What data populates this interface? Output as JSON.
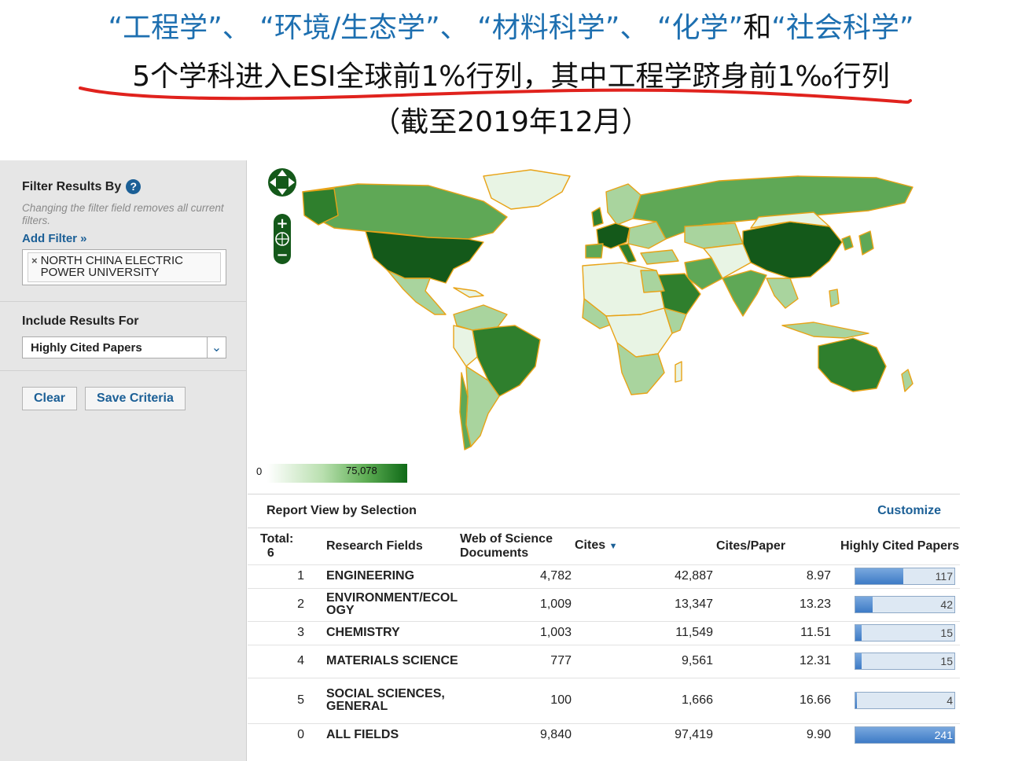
{
  "slide": {
    "line1_parts": [
      "“工程学”",
      "、",
      "“环境/生态学”",
      "、",
      "“材料科学”",
      "、",
      "“化学”"
    ],
    "line1_and": "和",
    "line1_last": "“社会科学”",
    "line2": "5个学科进入ESI全球前1%行列，其中工程学跻身前1‰行列",
    "line3": "（截至2019年12月）"
  },
  "sidebar": {
    "filter_heading": "Filter Results By",
    "help_icon": "question-icon",
    "filter_note": "Changing the filter field removes all current filters.",
    "add_filter": "Add Filter »",
    "active_filter": "NORTH CHINA ELECTRIC POWER UNIVERSITY",
    "include_heading": "Include Results For",
    "include_value": "Highly Cited Papers",
    "clear_label": "Clear",
    "save_label": "Save Criteria"
  },
  "map": {
    "legend_min": "0",
    "legend_max": "75,078",
    "colors": {
      "ocean": "#ffffff",
      "border": "#e8a317",
      "darkest": "#14591a",
      "dark": "#2f7f2d",
      "mid": "#5fa856",
      "light": "#a9d49e",
      "lightest": "#e8f4e4"
    }
  },
  "report": {
    "title": "Report View by Selection",
    "customize": "Customize",
    "columns": {
      "total_label": "Total:",
      "total_value": "6",
      "field": "Research Fields",
      "docs": "Web of Science Documents",
      "cites": "Cites",
      "cpp": "Cites/Paper",
      "hcp": "Highly Cited Papers"
    },
    "rows": [
      {
        "rank": "1",
        "field": "ENGINEERING",
        "docs": "4,782",
        "cites": "42,887",
        "cpp": "8.97",
        "hcp": "117",
        "hcp_value": 117
      },
      {
        "rank": "2",
        "field": "ENVIRONMENT/ECOLOGY",
        "docs": "1,009",
        "cites": "13,347",
        "cpp": "13.23",
        "hcp": "42",
        "hcp_value": 42
      },
      {
        "rank": "3",
        "field": "CHEMISTRY",
        "docs": "1,003",
        "cites": "11,549",
        "cpp": "11.51",
        "hcp": "15",
        "hcp_value": 15
      },
      {
        "rank": "4",
        "field": "MATERIALS SCIENCE",
        "docs": "777",
        "cites": "9,561",
        "cpp": "12.31",
        "hcp": "15",
        "hcp_value": 15
      },
      {
        "rank": "5",
        "field": "SOCIAL SCIENCES, GENERAL",
        "docs": "100",
        "cites": "1,666",
        "cpp": "16.66",
        "hcp": "4",
        "hcp_value": 4
      },
      {
        "rank": "0",
        "field": "ALL FIELDS",
        "docs": "9,840",
        "cites": "97,419",
        "cpp": "9.90",
        "hcp": "241",
        "hcp_value": 241
      }
    ],
    "hcp_max": 241
  }
}
